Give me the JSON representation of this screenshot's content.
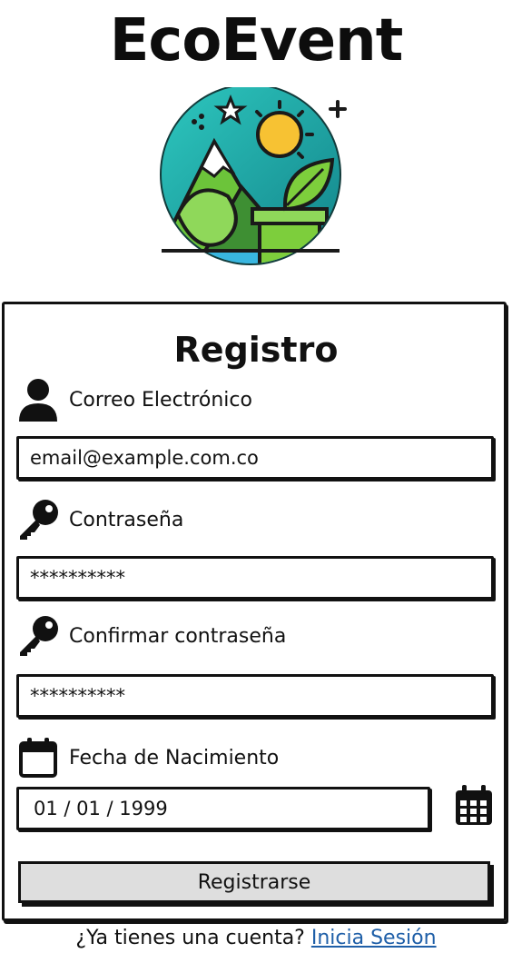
{
  "app": {
    "title": "EcoEvent"
  },
  "form": {
    "title": "Registro",
    "email": {
      "label": "Correo Electrónico",
      "value": "email@example.com.co"
    },
    "password": {
      "label": "Contraseña",
      "value": "**********"
    },
    "confirm_password": {
      "label": "Confirmar contraseña",
      "value": "**********"
    },
    "birthdate": {
      "label": "Fecha de Nacimiento",
      "value": "01 / 01 / 1999"
    },
    "submit_label": "Registrarse"
  },
  "footer": {
    "prompt": "¿Ya tienes una cuenta?",
    "link_label": "Inicia Sesión"
  },
  "icons": {
    "email": "user-icon",
    "password": "key-icon",
    "confirm_password": "key-icon",
    "birthdate": "calendar-icon",
    "date_picker": "calendar-grid-icon"
  },
  "colors": {
    "logo_teal": "#1ba6a0",
    "logo_green": "#7dce3c",
    "logo_sun": "#f7c233",
    "link": "#1f5fa8",
    "button_bg": "#dedede"
  }
}
